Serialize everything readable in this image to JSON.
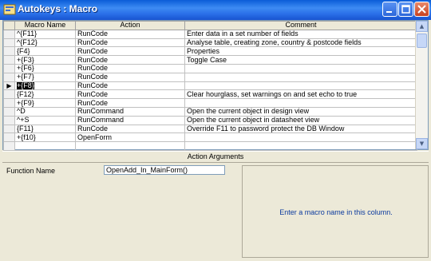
{
  "window": {
    "title": "Autokeys : Macro",
    "accent": "#1854D0"
  },
  "grid": {
    "headers": [
      "Macro Name",
      "Action",
      "Comment"
    ],
    "rows": [
      {
        "name": "^{F11}",
        "action": "RunCode",
        "comment": "Enter data in a set number of fields"
      },
      {
        "name": "^{F12}",
        "action": "RunCode",
        "comment": "Analyse table, creating zone, country & postcode fields"
      },
      {
        "name": "{F4}",
        "action": "RunCode",
        "comment": "Properties"
      },
      {
        "name": "+{F3}",
        "action": "RunCode",
        "comment": "Toggle Case"
      },
      {
        "name": "+{F6}",
        "action": "RunCode",
        "comment": ""
      },
      {
        "name": "+{F7}",
        "action": "RunCode",
        "comment": ""
      },
      {
        "name": "+{F8}",
        "action": "RunCode",
        "comment": ""
      },
      {
        "name": "{F12}",
        "action": "RunCode",
        "comment": "Clear hourglass, set warnings on and set echo to true"
      },
      {
        "name": "+{F9}",
        "action": "RunCode",
        "comment": ""
      },
      {
        "name": "^D",
        "action": "RunCommand",
        "comment": "Open the current object in design view"
      },
      {
        "name": "^+S",
        "action": "RunCommand",
        "comment": "Open the current object in datasheet view"
      },
      {
        "name": "{F11}",
        "action": "RunCode",
        "comment": "Override F11 to password protect the DB Window"
      },
      {
        "name": "+{f10}",
        "action": "OpenForm",
        "comment": ""
      },
      {
        "name": "",
        "action": "",
        "comment": ""
      }
    ],
    "selected_row_marker": "▶"
  },
  "args": {
    "header": "Action Arguments",
    "function_name_label": "Function Name",
    "function_name_value": "OpenAdd_In_MainForm()",
    "hint": "Enter a macro name in this column."
  }
}
